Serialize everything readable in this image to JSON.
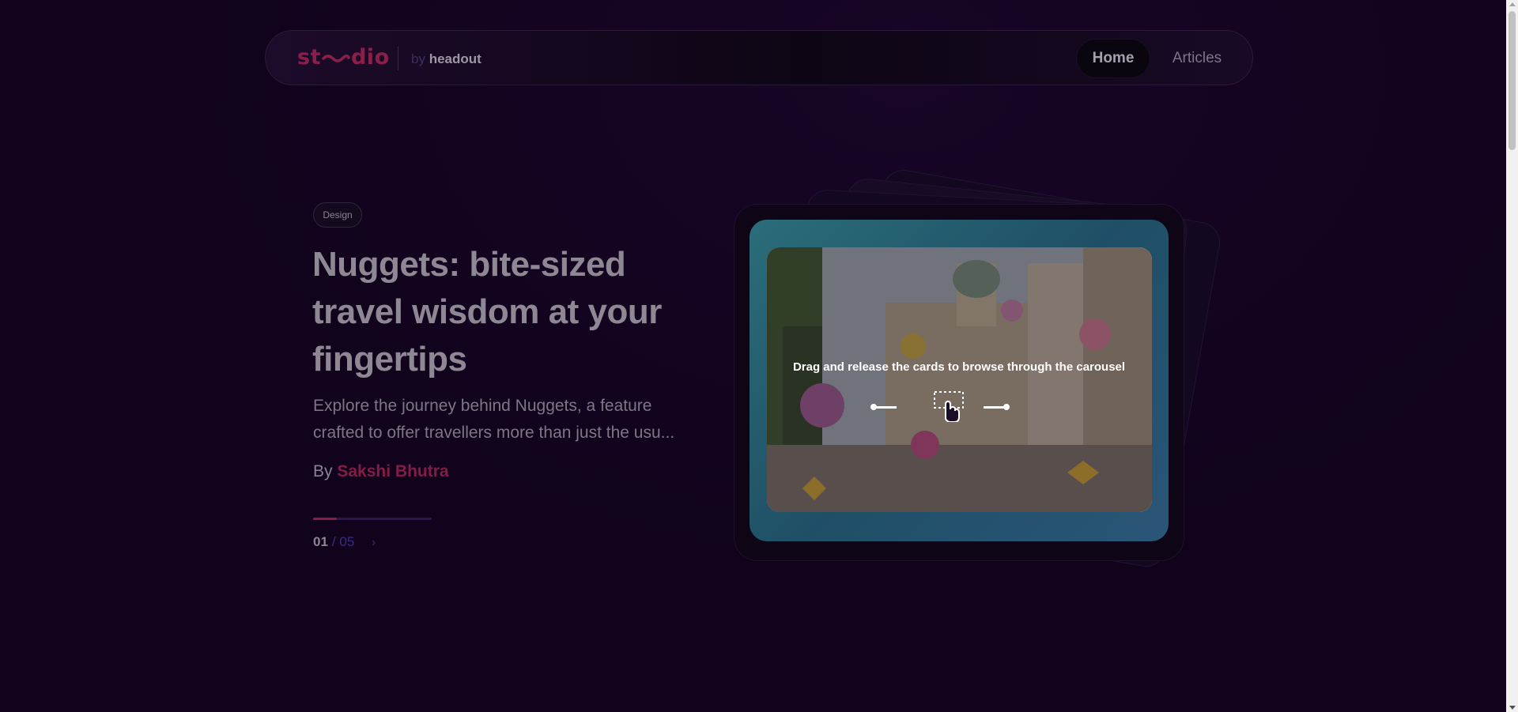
{
  "nav": {
    "logo_left": "st",
    "logo_right": "dio",
    "by": "by",
    "brand": "headout",
    "links": [
      "Home",
      "Articles"
    ]
  },
  "hero": {
    "tag": "Design",
    "title": "Nuggets: bite-sized travel wisdom at your fingertips",
    "description_lines": [
      "Explore the journey behind Nuggets, a feature",
      "crafted to offer travellers more than just the usu..."
    ],
    "author_prefix": "By",
    "author_name": "Sakshi Bhutra",
    "progress_fraction": 0.2,
    "pager_current": "01",
    "pager_total": "/ 05"
  },
  "carousel": {
    "hint": "Drag and release the cards to browse through the carousel"
  },
  "icons": [
    "wave-icon",
    "chevron-right-icon",
    "drag-hand-icon"
  ],
  "colors": {
    "background": "#10031b",
    "accent": "#8c1c46",
    "card_teal": "#2b6d7a"
  }
}
